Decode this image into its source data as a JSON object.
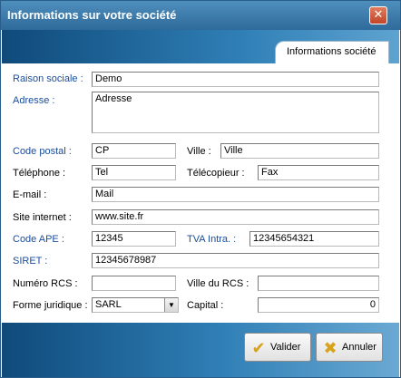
{
  "window": {
    "title": "Informations sur votre société",
    "close_glyph": "✕"
  },
  "tab": {
    "label": "Informations  société"
  },
  "form": {
    "raison_sociale": {
      "label": "Raison sociale :",
      "value": "Demo"
    },
    "adresse": {
      "label": "Adresse :",
      "value": "Adresse"
    },
    "code_postal": {
      "label": "Code postal :",
      "value": "CP"
    },
    "ville": {
      "label": "Ville :",
      "value": "Ville"
    },
    "telephone": {
      "label": "Téléphone :",
      "value": "Tel"
    },
    "telecopieur": {
      "label": "Télécopieur :",
      "value": "Fax"
    },
    "email": {
      "label": "E-mail :",
      "value": "Mail"
    },
    "site_internet": {
      "label": "Site internet :",
      "value": "www.site.fr"
    },
    "code_ape": {
      "label": "Code APE :",
      "value": "12345"
    },
    "tva_intra": {
      "label": "TVA Intra. :",
      "value": "12345654321"
    },
    "siret": {
      "label": "SIRET :",
      "value": "12345678987"
    },
    "numero_rcs": {
      "label": "Numéro RCS :",
      "value": ""
    },
    "ville_rcs": {
      "label": "Ville du RCS :",
      "value": ""
    },
    "forme_juridique": {
      "label": "Forme juridique :",
      "value": "SARL"
    },
    "capital": {
      "label": "Capital :",
      "value": "0"
    }
  },
  "buttons": {
    "valider": {
      "label": "Valider",
      "icon": "checkmark-icon",
      "glyph": "✔"
    },
    "annuler": {
      "label": "Annuler",
      "icon": "cross-icon",
      "glyph": "✖"
    }
  },
  "colors": {
    "label_blue": "#1a4d9c",
    "title_bar": "#3a78a8",
    "band_dark": "#0f4a7a",
    "band_light": "#5ea3d0"
  }
}
